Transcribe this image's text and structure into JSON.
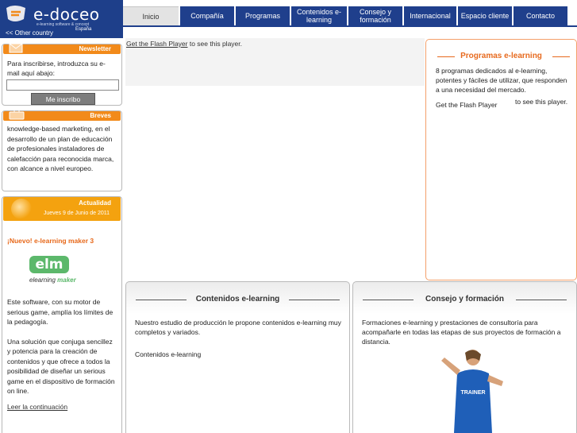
{
  "header": {
    "logo_text": "e-doceo",
    "logo_tagline": "e-learning software & concept",
    "other_country": "<< Other country",
    "country": "España"
  },
  "nav": {
    "items": [
      {
        "label": "Inicio",
        "active": true
      },
      {
        "label": "Compañía"
      },
      {
        "label": "Programas"
      },
      {
        "label": "Contenidos e-learning"
      },
      {
        "label": "Consejo y formación"
      },
      {
        "label": "Internacional"
      },
      {
        "label": "Espacio cliente"
      },
      {
        "label": "Contacto"
      }
    ]
  },
  "newsletter": {
    "title": "Newsletter",
    "text": "Para inscribirse, introduzca su e-mail aquí abajo:",
    "input_value": "",
    "button": "Me inscribo"
  },
  "breves": {
    "title": "Breves",
    "text": "knowledge-based marketing, en el desarrollo de un plan de educación de profesionales instaladores de calefacción para reconocida marca, con alcance a nivel europeo."
  },
  "actualidad": {
    "title": "Actualidad",
    "date": "Jueves 9 de Junio de 2011",
    "headline": "¡Nuevo! e-learning maker 3",
    "logo_text": "elm",
    "logo_sub_1": "elearning",
    "logo_sub_2": "maker",
    "paragraph_1": "Este software, con su motor de serious game, amplía los límites de la pedagogía.",
    "paragraph_2": "Una solución que conjuga sencillez y potencia para la creación de contenidos y que ofrece a todos la posibilidad de diseñar un serious game en el dispositivo de formación on line.",
    "link": "Leer la continuación"
  },
  "flash": {
    "link": "Get the Flash Player",
    "suffix": " to see this player."
  },
  "programas": {
    "title": "Programas e-learning",
    "text": "8 programas dedicados al e-learning, potentes y fáciles de utilizar, que responden a una necesidad del mercado.",
    "flash_link": "Get the Flash Player",
    "flash_suffix": "to see this player."
  },
  "contenidos": {
    "title": "Contenidos e-learning",
    "text": "Nuestro estudio de producción le propone contenidos e-learning muy completos y variados.",
    "sub": "Contenidos e-learning"
  },
  "consejo": {
    "title": "Consejo y formación",
    "text": "Formaciones e-learning y prestaciones de consultoría para acompañarle en todas las etapas de sus proyectos de formación a distancia.",
    "shirt_text": "TRAINER"
  },
  "colors": {
    "brand_blue": "#1f3f8c",
    "orange": "#f28a1a",
    "accent_orange": "#e76a1e",
    "green": "#5cb86b"
  }
}
